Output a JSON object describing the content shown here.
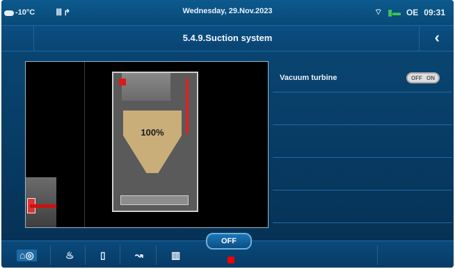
{
  "status": {
    "temperature": "-10°C",
    "date": "Wednesday, 29.Nov.2023",
    "oe_label": "OE",
    "time": "09:31"
  },
  "header": {
    "title": "5.4.9.Suction system",
    "back_icon": "chevron-left-icon"
  },
  "view": {
    "fill_level": "100%"
  },
  "settings": {
    "rows": [
      {
        "label": "Vacuum turbine",
        "toggle_on": "ON",
        "toggle_off": "OFF"
      }
    ]
  },
  "bottom": {
    "off_label": "OFF",
    "icons": [
      "mode-icon",
      "flame-icon",
      "phone-icon",
      "pump-icon",
      "radiator-icon"
    ]
  },
  "colors": {
    "accent": "#0a4a78",
    "alarm": "#e00000"
  }
}
